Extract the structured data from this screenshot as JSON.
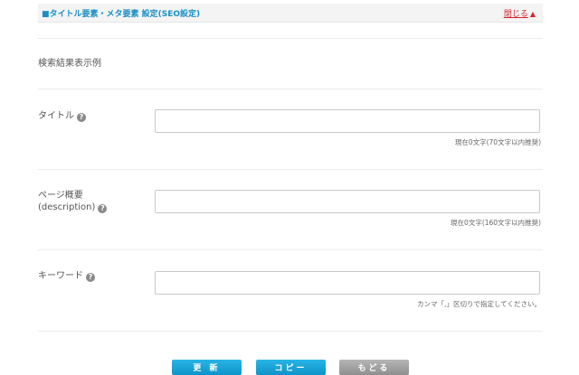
{
  "header": {
    "title": "■タイトル要素・メタ要素 設定(SEO設定)",
    "close_label": "閉じる",
    "close_icon": "▲"
  },
  "preview": {
    "label": "検索結果表示例"
  },
  "fields": {
    "title": {
      "label": "タイトル",
      "value": "",
      "hint": "現在0文字(70文字以内推奨)"
    },
    "description": {
      "label_line1": "ページ概要",
      "label_line2": "(description)",
      "value": "",
      "hint": "現在0文字(160文字以内推奨)"
    },
    "keywords": {
      "label": "キーワード",
      "value": "",
      "hint": "カンマ「,」区切りで指定してください。"
    }
  },
  "help_icon_glyph": "?",
  "buttons": {
    "update": "更 新",
    "copy": "コピー",
    "back": "もどる"
  },
  "colors": {
    "title_blue": "#1a8fc4",
    "close_red": "#d9232d",
    "button_blue": "#0e93c8",
    "button_gray": "#8f8f8f"
  }
}
